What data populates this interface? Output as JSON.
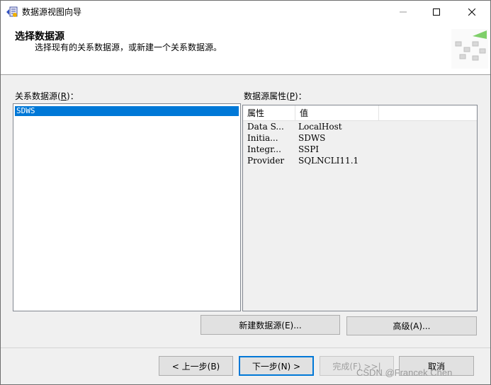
{
  "window": {
    "title": "数据源视图向导"
  },
  "header": {
    "title": "选择数据源",
    "subtitle": "选择现有的关系数据源，或新建一个关系数据源。"
  },
  "left_panel": {
    "label_prefix": "关系数据源(",
    "label_key": "R",
    "label_suffix": ")：",
    "items": [
      "SDWS"
    ],
    "selected": "SDWS"
  },
  "right_panel": {
    "label_prefix": "数据源属性(",
    "label_key": "P",
    "label_suffix": ")：",
    "columns": [
      "属性",
      "值"
    ],
    "rows": [
      {
        "name": "Data S...",
        "value": "LocalHost"
      },
      {
        "name": "Initia...",
        "value": "SDWS"
      },
      {
        "name": "Integr...",
        "value": "SSPI"
      },
      {
        "name": "Provider",
        "value": "SQLNCLI11.1"
      }
    ]
  },
  "actions": {
    "new_datasource": "新建数据源(E)...",
    "advanced": "高级(A)..."
  },
  "footer": {
    "back": "< 上一步(B)",
    "next": "下一步(N) >",
    "finish": "完成(F) >>|",
    "cancel": "取消"
  },
  "watermark": "CSDN @Francek Chen",
  "colors": {
    "selection": "#0078d7",
    "default_button_border": "#0078d7"
  }
}
